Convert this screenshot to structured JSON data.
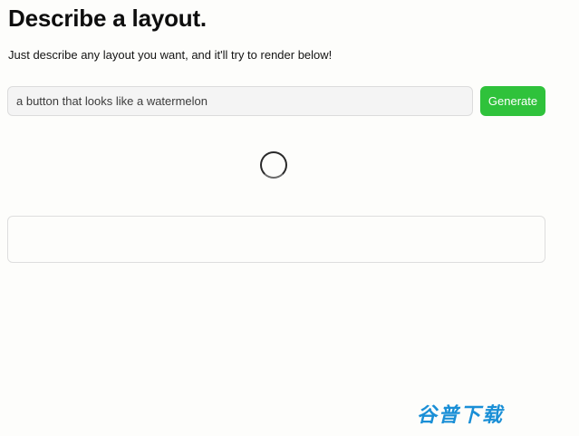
{
  "header": {
    "title": "Describe a layout.",
    "subtitle": "Just describe any layout you want, and it'll try to render below!"
  },
  "form": {
    "input_value": "a button that looks like a watermelon",
    "generate_label": "Generate"
  },
  "status": {
    "loading": true
  },
  "output": {
    "content": ""
  },
  "watermark": {
    "text": "谷普下载"
  },
  "colors": {
    "background": "#fdfdfb",
    "accent": "#2fc23b",
    "watermark": "#1a8fd6"
  }
}
